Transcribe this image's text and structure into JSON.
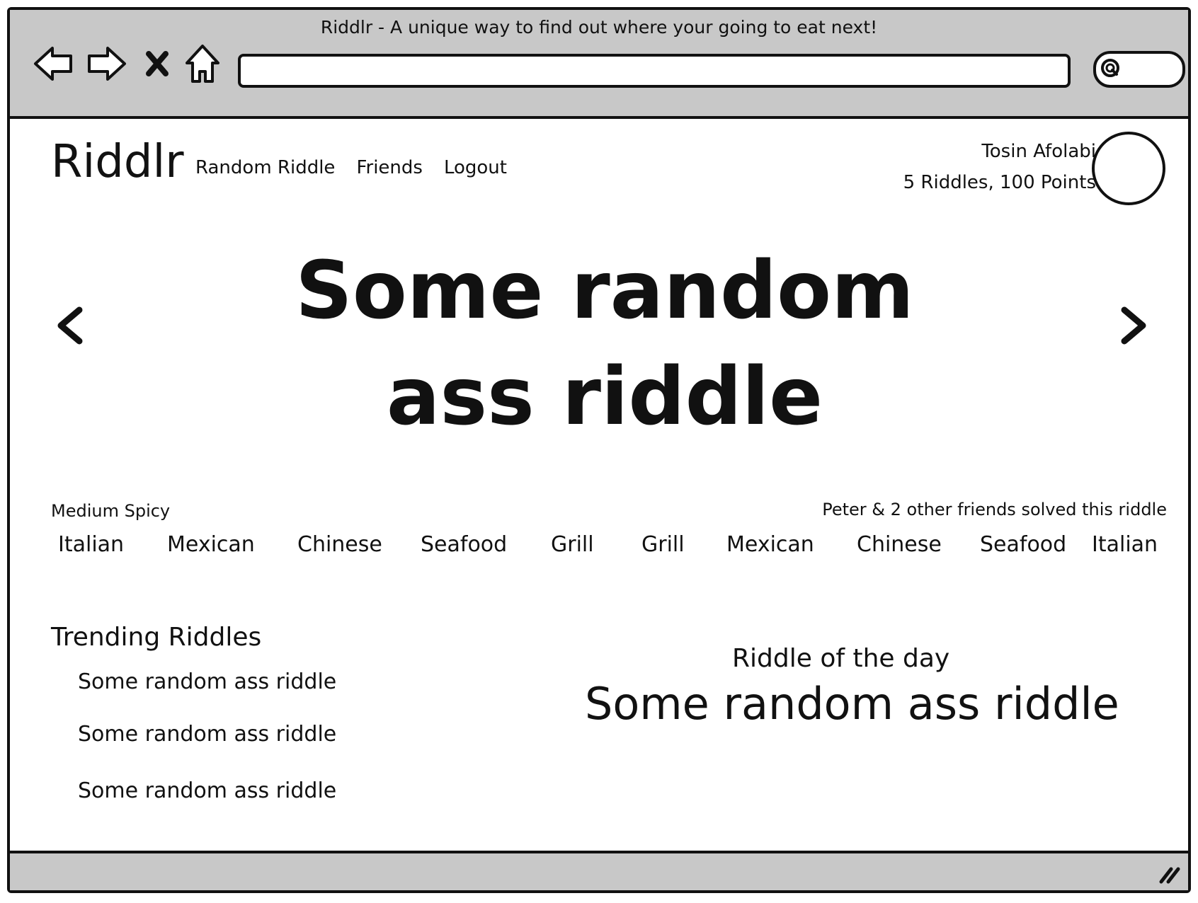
{
  "window": {
    "title": "Riddlr - A unique way to find out where your going to eat next!",
    "url": "",
    "search_value": ""
  },
  "header": {
    "logo": "Riddlr",
    "nav": [
      "Random Riddle",
      "Friends",
      "Logout"
    ],
    "user_name": "Tosin Afolabi",
    "user_stats": "5 Riddles, 100 Points"
  },
  "hero": {
    "riddle_line1": "Some random",
    "riddle_line2": "ass riddle"
  },
  "riddle_meta": {
    "spice_level": "Medium Spicy",
    "solved_by": "Peter & 2 other friends solved this riddle"
  },
  "cuisines": [
    "Italian",
    "Mexican",
    "Chinese",
    "Seafood",
    "Grill",
    "Grill",
    "Mexican",
    "Chinese",
    "Seafood",
    "Italian"
  ],
  "trending": {
    "title": "Trending Riddles",
    "items": [
      "Some random ass riddle",
      "Some random ass riddle",
      "Some random ass riddle"
    ]
  },
  "riddle_of_the_day": {
    "title": "Riddle of the day",
    "text": "Some random ass riddle"
  },
  "icons": {
    "back": "back-arrow-icon",
    "forward": "forward-arrow-icon",
    "stop": "close-icon",
    "home": "home-icon",
    "search": "search-icon",
    "prev": "chevron-left-icon",
    "next": "chevron-right-icon",
    "resize": "resize-grip-icon"
  },
  "colors": {
    "chrome": "#c8c8c8",
    "ink": "#111111",
    "background": "#ffffff"
  }
}
